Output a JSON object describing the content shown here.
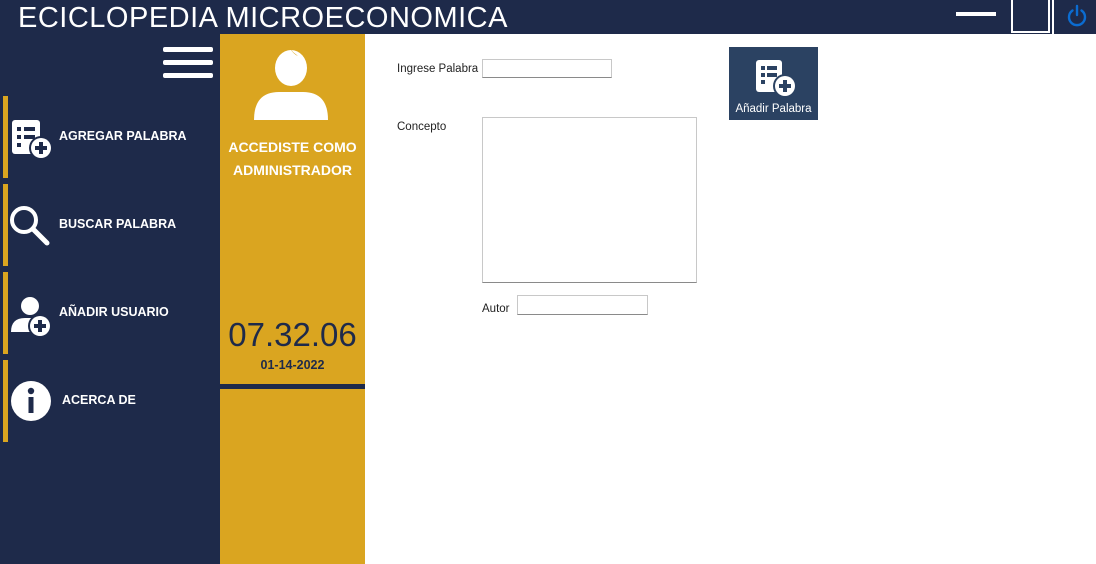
{
  "app": {
    "title": "ECICLOPEDIA MICROECONOMICA"
  },
  "window_controls": {
    "icons": [
      "minimize-icon",
      "maximize-icon",
      "power-icon"
    ],
    "power_color": "#0b6cd1"
  },
  "sidebar": {
    "items": [
      {
        "label": "AGREGAR PALABRA",
        "icon": "add-word-icon"
      },
      {
        "label": "BUSCAR PALABRA",
        "icon": "search-icon"
      },
      {
        "label": "AÑADIR USUARIO",
        "icon": "add-user-icon"
      },
      {
        "label": "ACERCA DE",
        "icon": "info-icon"
      }
    ]
  },
  "user_panel": {
    "avatar_icon": "user-icon",
    "role_text": "ACCEDISTE COMO ADMINISTRADOR",
    "time": "07.32.06",
    "date": "01-14-2022"
  },
  "form": {
    "word_label": "Ingrese Palabra",
    "word_value": "",
    "concept_label": "Concepto",
    "concept_value": "",
    "author_label": "Autor",
    "author_value": "",
    "add_button_label": "Añadir Palabra"
  },
  "colors": {
    "navy": "#1e2a4a",
    "gold": "#daa520",
    "button_bg": "#2b4262"
  }
}
